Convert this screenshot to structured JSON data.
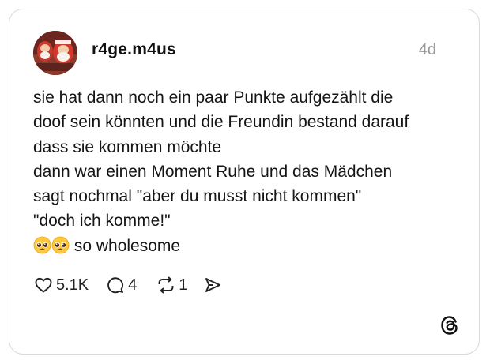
{
  "post": {
    "username": "r4ge.m4us",
    "time": "4d",
    "lines": [
      "sie hat dann noch ein paar Punkte aufgezählt die",
      "doof sein könnten und die Freundin bestand darauf",
      "dass sie kommen möchte",
      "dann war einen Moment Ruhe und das Mädchen",
      "sagt nochmal \"aber du musst nicht kommen\"",
      "\"doch ich komme!\""
    ],
    "last_line_text": "so wholesome",
    "last_line_emoji": "pleading-face-emoji"
  },
  "actions": {
    "likes": "5.1K",
    "replies": "4",
    "reposts": "1"
  },
  "app_logo": "threads-logo"
}
